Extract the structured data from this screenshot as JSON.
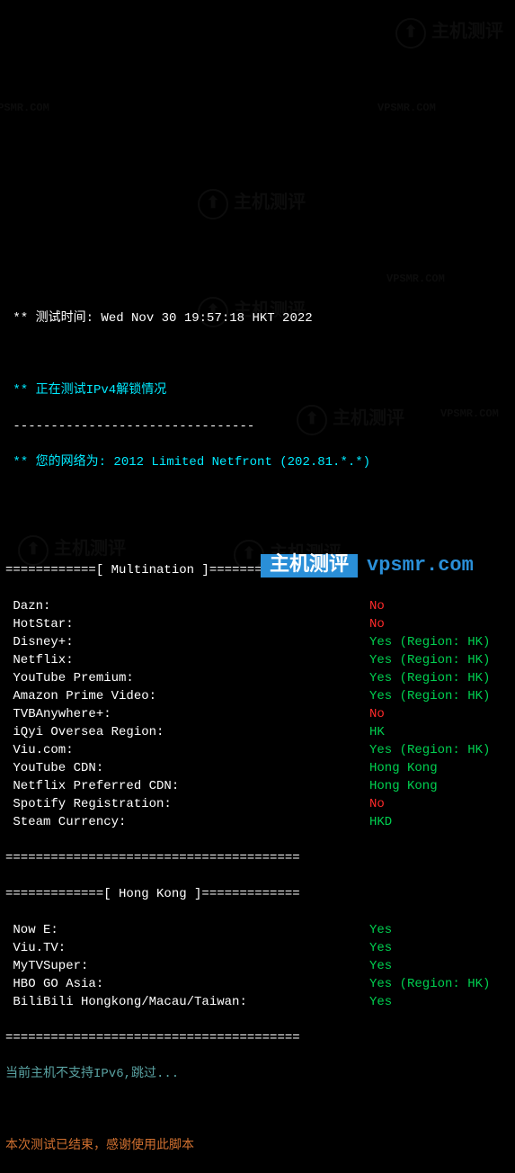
{
  "header": {
    "test_time_label": " ** 测试时间: ",
    "test_time_value": "Wed Nov 30 19:57:18 HKT 2022",
    "blank": "",
    "ipv4_testing": " ** 正在测试IPv4解锁情况",
    "dashes": " --------------------------------",
    "network_label": " ** 您的网络为: ",
    "network_value": "2012 Limited Netfront (202.81.*.*)"
  },
  "sections": {
    "multination_header": "============[ Multination ]============",
    "hongkong_header": "=============[ Hong Kong ]=============",
    "separator": "======================================="
  },
  "multination": [
    {
      "label": " Dazn:",
      "value": "No",
      "color": "red"
    },
    {
      "label": " HotStar:",
      "value": "No",
      "color": "red"
    },
    {
      "label": " Disney+:",
      "value": "Yes (Region: HK)",
      "color": "green"
    },
    {
      "label": " Netflix:",
      "value": "Yes (Region: HK)",
      "color": "green"
    },
    {
      "label": " YouTube Premium:",
      "value": "Yes (Region: HK)",
      "color": "green"
    },
    {
      "label": " Amazon Prime Video:",
      "value": "Yes (Region: HK)",
      "color": "green"
    },
    {
      "label": " TVBAnywhere+:",
      "value": "No",
      "color": "red"
    },
    {
      "label": " iQyi Oversea Region:",
      "value": "HK",
      "color": "green"
    },
    {
      "label": " Viu.com:",
      "value": "Yes (Region: HK)",
      "color": "green"
    },
    {
      "label": " YouTube CDN:",
      "value": "Hong Kong",
      "color": "green"
    },
    {
      "label": " Netflix Preferred CDN:",
      "value": "Hong Kong",
      "color": "green"
    },
    {
      "label": " Spotify Registration:",
      "value": "No",
      "color": "red"
    },
    {
      "label": " Steam Currency:",
      "value": "HKD",
      "color": "green"
    }
  ],
  "hongkong": [
    {
      "label": " Now E:",
      "value": "Yes",
      "color": "green"
    },
    {
      "label": " Viu.TV:",
      "value": "Yes",
      "color": "green"
    },
    {
      "label": " MyTVSuper:",
      "value": "Yes",
      "color": "green"
    },
    {
      "label": " HBO GO Asia:",
      "value": "Yes (Region: HK)",
      "color": "green"
    },
    {
      "label": " BiliBili Hongkong/Macau/Taiwan:",
      "value": "Yes",
      "color": "green"
    }
  ],
  "footer": {
    "ipv6_skip": "当前主机不支持IPv6,跳过...",
    "test_end": "本次测试已结束，感谢使用此脚本"
  },
  "watermarks": {
    "text_cn": "主机测评",
    "text_en": "VPSMR.COM",
    "domain": "vpsmr.com"
  }
}
